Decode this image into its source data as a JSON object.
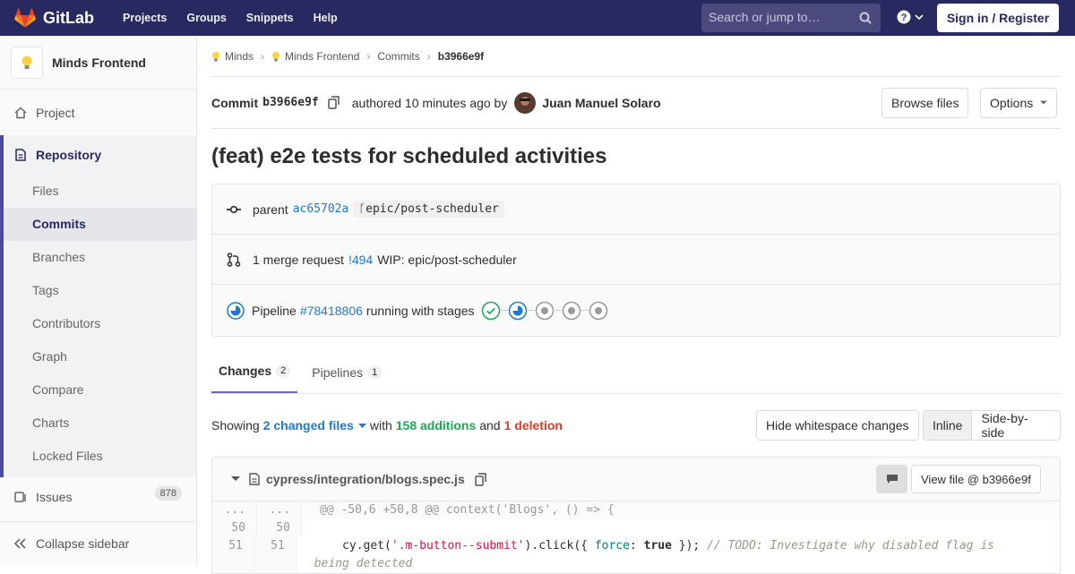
{
  "navbar": {
    "brand": "GitLab",
    "links": [
      "Projects",
      "Groups",
      "Snippets",
      "Help"
    ],
    "search_placeholder": "Search or jump to…",
    "sign_in": "Sign in / Register"
  },
  "sidebar": {
    "project_name": "Minds Frontend",
    "project": "Project",
    "repository": "Repository",
    "repo_items": [
      "Files",
      "Commits",
      "Branches",
      "Tags",
      "Contributors",
      "Graph",
      "Compare",
      "Charts",
      "Locked Files"
    ],
    "active_item": "Commits",
    "issues": "Issues",
    "issues_count": "878",
    "collapse": "Collapse sidebar"
  },
  "breadcrumbs": [
    "Minds",
    "Minds Frontend",
    "Commits",
    "b3966e9f"
  ],
  "commit": {
    "label": "Commit",
    "sha": "b3966e9f",
    "authored": "authored 10 minutes ago by",
    "author": "Juan Manuel Solaro",
    "browse_files": "Browse files",
    "options": "Options",
    "title": "(feat) e2e tests for scheduled activities"
  },
  "info": {
    "parent_label": "parent",
    "parent_sha": "ac65702a",
    "branch": "epic/post-scheduler",
    "mr_prefix": "1 merge request",
    "mr_id": "!494",
    "mr_title": "WIP: epic/post-scheduler",
    "pipeline_label": "Pipeline",
    "pipeline_id": "#78418806",
    "pipeline_status": "running with stages"
  },
  "tabs": [
    {
      "label": "Changes",
      "count": "2"
    },
    {
      "label": "Pipelines",
      "count": "1"
    }
  ],
  "summary": {
    "showing": "Showing",
    "files": "2 changed files",
    "with": "with",
    "additions": "158 additions",
    "and": "and",
    "deletions": "1 deletion",
    "hide_ws": "Hide whitespace changes",
    "inline": "Inline",
    "side_by_side": "Side-by-side"
  },
  "file": {
    "path": "cypress/integration/blogs.spec.js",
    "view_file": "View file @ b3966e9f"
  },
  "diff": {
    "hunk_old": "...",
    "hunk_new": "...",
    "hunk": "@@ -50,6 +50,8 @@ context('Blogs', () => {",
    "line50_old": "50",
    "line50_new": "50",
    "line51_old": "51",
    "line51_new": "51",
    "code51_a": "cy",
    "code51_b": ".get(",
    "code51_c": "'.m-button--submit'",
    "code51_d": ").click({ ",
    "code51_e": "force",
    "code51_f": ": ",
    "code51_g": "true",
    "code51_h": " }); ",
    "code51_comment": "// TODO: Investigate why disabled flag is being",
    "code51_cont": "detected"
  },
  "colors": {
    "navbar": "#292961",
    "link": "#1f78d1",
    "additions": "#1aaa55",
    "deletions": "#db3b21"
  }
}
